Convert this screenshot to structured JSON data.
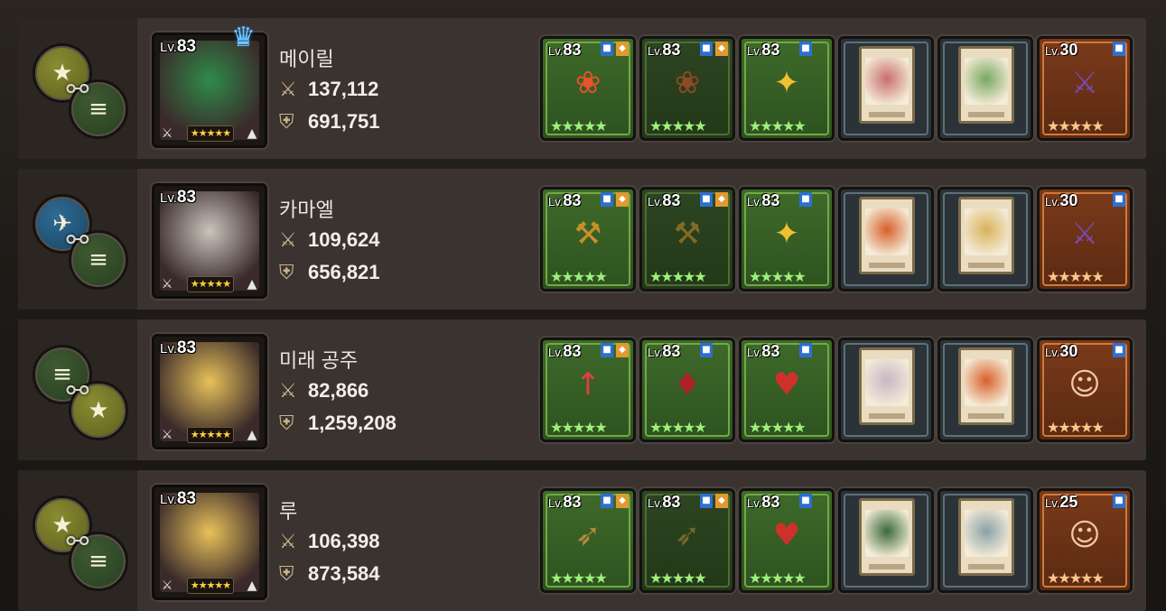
{
  "rows": [
    {
      "name": "메이릴",
      "level_label": "Lv.",
      "level": "83",
      "atk": "137,112",
      "def": "691,751",
      "leader_crown": true,
      "synergy": [
        "olive",
        "green"
      ],
      "portrait_color": "#2f8b4a",
      "items": [
        {
          "lv": "83",
          "kind": "green",
          "tags": [
            "blue",
            "orange"
          ],
          "item": "flower-icon"
        },
        {
          "lv": "83",
          "kind": "dim",
          "tags": [
            "blue",
            "orange"
          ],
          "item": "flower-icon"
        },
        {
          "lv": "83",
          "kind": "green",
          "tags": [
            "blue"
          ],
          "item": "amulet-icon"
        },
        {
          "kind": "dark",
          "card_color": "#c86e6e",
          "item": "card-icon"
        },
        {
          "kind": "dark",
          "card_color": "#7aa860",
          "item": "card-icon"
        },
        {
          "lv": "30",
          "kind": "orange",
          "tags": [
            "blue"
          ],
          "item": "ship-icon"
        }
      ]
    },
    {
      "name": "카마엘",
      "level_label": "Lv.",
      "level": "83",
      "atk": "109,624",
      "def": "656,821",
      "leader_crown": false,
      "synergy": [
        "blue",
        "green"
      ],
      "portrait_color": "#c9c4bc",
      "items": [
        {
          "lv": "83",
          "kind": "green",
          "tags": [
            "blue",
            "orange"
          ],
          "item": "scythe-icon"
        },
        {
          "lv": "83",
          "kind": "dim",
          "tags": [
            "blue",
            "orange"
          ],
          "item": "scythe-icon"
        },
        {
          "lv": "83",
          "kind": "green",
          "tags": [
            "blue"
          ],
          "item": "amulet-icon"
        },
        {
          "kind": "dark",
          "card_color": "#d7602a",
          "item": "card-icon"
        },
        {
          "kind": "dark",
          "card_color": "#d8b25a",
          "item": "card-icon"
        },
        {
          "lv": "30",
          "kind": "orange",
          "tags": [
            "blue"
          ],
          "item": "ship-icon"
        }
      ]
    },
    {
      "name": "미래 공주",
      "level_label": "Lv.",
      "level": "83",
      "atk": "82,866",
      "def": "1,259,208",
      "leader_crown": false,
      "synergy": [
        "green",
        "olive"
      ],
      "portrait_color": "#e8c25a",
      "items": [
        {
          "lv": "83",
          "kind": "green",
          "tags": [
            "blue",
            "orange"
          ],
          "item": "spear-icon"
        },
        {
          "lv": "83",
          "kind": "green",
          "tags": [
            "blue"
          ],
          "item": "armor-icon"
        },
        {
          "lv": "83",
          "kind": "green",
          "tags": [
            "blue"
          ],
          "item": "necklace-icon"
        },
        {
          "kind": "dark",
          "card_color": "#c9b6c4",
          "item": "card-icon"
        },
        {
          "kind": "dark",
          "card_color": "#d8602a",
          "item": "card-icon"
        },
        {
          "lv": "30",
          "kind": "orange",
          "tags": [
            "blue"
          ],
          "item": "face-icon"
        }
      ]
    },
    {
      "name": "루",
      "level_label": "Lv.",
      "level": "83",
      "atk": "106,398",
      "def": "873,584",
      "leader_crown": false,
      "synergy": [
        "olive",
        "green"
      ],
      "portrait_color": "#e8c25a",
      "items": [
        {
          "lv": "83",
          "kind": "green",
          "tags": [
            "blue",
            "orange"
          ],
          "item": "gun-icon"
        },
        {
          "lv": "83",
          "kind": "dim",
          "tags": [
            "blue",
            "orange"
          ],
          "item": "gun-icon"
        },
        {
          "lv": "83",
          "kind": "green",
          "tags": [
            "blue"
          ],
          "item": "necklace-icon"
        },
        {
          "kind": "dark",
          "card_color": "#3a6a3a",
          "item": "card-icon"
        },
        {
          "kind": "dark",
          "card_color": "#8aa2a8",
          "item": "card-icon"
        },
        {
          "lv": "25",
          "kind": "orange",
          "tags": [
            "blue"
          ],
          "item": "face-icon"
        }
      ]
    }
  ]
}
